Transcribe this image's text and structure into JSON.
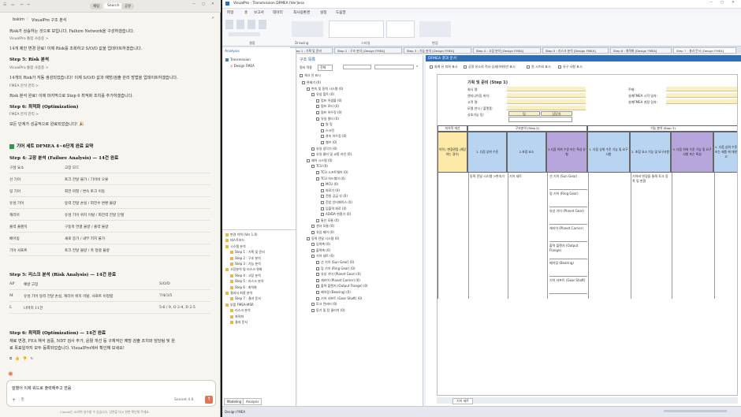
{
  "left": {
    "title": "VisualPro 구조 분석",
    "crumb": "bskim",
    "top_tabs": [
      "채팅",
      "Search",
      "공유"
    ],
    "lines": [
      "Risk가 상승하는 것으로 보입니다. Failure Network을 구성하겠습니다.",
      "VisualPro 통합 사용중 >",
      "14개 제안 변경 완료! 이제 Risk를 조회하고 S/O/D 값을 업데이트하겠습니다.",
      "Step 5: Risk 분석",
      "VisualPro 통합 사용중 >",
      "14개의 Risk가 자동 생성되었습니다! 이제 S/O/D 값과 예방/검출 관리 방법을 업데이트하겠습니다.",
      "FMEA 분석 관리 >",
      "Risk 분석 완료! 이제 마지막으로 Step 6 최적화 조치를 추가하겠습니다.",
      "Step 6: 최적화 (Optimization)",
      "FMEA 분석 관리 >",
      "모든 단계가 성공적으로 완료되었습니다! 🎉"
    ],
    "summary_title": "기어 세트 DFMEA 4~6단계 완료 요약",
    "step4_title": "Step 4: 고장 분석 (Failure Analysis) — 14건 완료",
    "step4_cols": [
      "구성 요소",
      "고장 모드"
    ],
    "step4_rows": [
      [
        "선 기어",
        "토크 전달 불가 / 기어비 오류"
      ],
      [
        "링 기어",
        "회전 마찰 / 변속 토크 이동"
      ],
      [
        "유성 기어",
        "등력 전달 손실 / 회전수 변환 불량"
      ],
      [
        "캐리어",
        "유성 기어 위치 이탈 / 회전력 전달 단절"
      ],
      [
        "출력 플랜지",
        "구동축 연결 불량 / 출력 불량"
      ],
      [
        "베어링",
        "새로 증가 / 내부 지지 불가"
      ],
      [
        "기어 샤프트",
        "토크 전달 불량 / 축 정렬 불량"
      ]
    ],
    "step5_title": "Step 5: 리스크 분석 (Risk Analysis) — 14건 완료",
    "step5_cols": [
      "AP",
      "예방 고장",
      "S/O/D"
    ],
    "step5_rows": [
      [
        "M",
        "유성 기어 등력 전달 손실, 캐리어 위치 이탈, 샤프트 비정렬",
        "7/4/3/5"
      ],
      [
        "L",
        "나머지 11건",
        "5-6 / 9, O 2-4, D 2-5"
      ]
    ],
    "step6_title": "Step 6: 최적화 (Optimization) — 14건 완료",
    "step6_text1": "재료 변경, FEA 해석 검증, NDT 검사 추가, 윤활 개선 등 구체적인 예방·검출 조치와 담당팀 및 완",
    "step6_text2": "료 목표일까지 모두 등록되었습니다. VisualPro에서 확인해 보세요!",
    "input_text": "잘했어 이제 워드로 출력해주고 얻음",
    "model": "Sonnet 4.6",
    "disclaimer": "Claude는 AI이며 실수할 수 있습니다. 답변을 다시 한번 확인해 주세요."
  },
  "right": {
    "window_title": "VisualPro - Transmission DFMEA [Ver]ona",
    "menu": [
      "파일",
      "홈",
      "보고서",
      "데이터",
      "최사용환경",
      "설정",
      "도움말"
    ],
    "ribbon_groups": [
      "결합",
      "Drawing",
      "스타일",
      "편집"
    ],
    "tabs": [
      "Step 1 : 기획 및 준비",
      "Step 2 : 구조 분석 [Design FMEA]",
      "Step 3 : 기능 분석 [Design FMEA]",
      "Step 4 : 고장 분석 [Design FMEA]",
      "Step 5 : 리스크 분석 [Design FMEA]",
      "Step 6 : 최적화 [Design FMEA]",
      "Step 7 : 결과 문서 [Design FMEA]"
    ],
    "analysis_title": "Analysis",
    "analysis_tree": [
      "Transmission",
      "Design FMEA"
    ],
    "struct_title": "구조 목록",
    "struct_opts": [
      "필터 적용",
      "전체",
      "체크 안 표시"
    ],
    "struct_tree": [
      "완제기 (0)",
      "변속 및 동력 시스템 (0)",
      "유일 힐트 (0)",
      "컴프 어셈블 (0)",
      "펌프 로터 (0)",
      "펌프 하우징 (0)",
      "유일 필터 (0)",
      "필 링",
      "스크린",
      "관속 하우징 (0)",
      "밸브 (0)",
      "유일 냉각기 (0)",
      "유일 쿨러 및 교종 라인 (0)",
      "제어 시스템 (0)",
      "TCU (0)",
      "TCU 소프트웨어 (0)",
      "TCU 하드웨어 (0)",
      "MCU (0)",
      "회로기 (0)",
      "전원 공급 부 (0)",
      "전압 인터페이스 (0)",
      "입출력 회로 (0)",
      "AD/DA 변환기 (0)",
      "통신 모듈 (0)",
      "센서 모듈 (0)",
      "유압 제어 (0)",
      "동력 전달 시스템 (0)",
      "입력축 (0)",
      "출력축 (0)",
      "기어 세트 (0)",
      "선 기어 (Sun Gear) (0)",
      "링 기어 (Ring Gear) (0)",
      "유성 기어 (Planet Gear) (0)",
      "캐리어 (Planet Carrier) (0)",
      "출력 플랜지 (Output Flange) (0)",
      "베어링 (Bearing) (0)",
      "기어 샤프트 (Gear Shaft) (0)",
      "토크 컨버터 (0)",
      "동기 및 탕 클러치 (0)"
    ],
    "nav_tree": [
      "변경 이력 (Ver 1.0)",
      "테스트보드",
      "시스템 분석",
      "Step 1 : 기획 및 준비",
      "Step 2 : 구조 분석",
      "Step 3 : 기능 분석",
      "고장분석 및 리스크 완화",
      "Step 4 : 고장 분석",
      "Step 5 : 리스크 분석",
      "Step 6 : 최적화",
      "결과서 최종 분석",
      "Step 7 : 결과 문서",
      "부품 FMEA-MSR",
      "리스크 분석",
      "최적화",
      "결과 문서"
    ],
    "bottom_tabs": [
      "Modeling",
      "Analysis"
    ],
    "doc_title": "DFMEA 결과 문서",
    "doc_opts": [
      "회계 유 미쳐 표시",
      "공정 유소의 적사 상세(하위)만 표시",
      "원 시즈워 표시",
      "유구 사항 표시"
    ],
    "plan_title": "기획 및 준비 (Step 1)",
    "plan_fields": [
      "회사 명:",
      "엔지니어링 위치:",
      "고객 명:",
      "모델 연식 / 플랫폼:",
      "상호기능 팀:"
    ],
    "plan_fields_right": [
      "주제:",
      "설계FMEA 시작 일자:",
      "설계FMEA 개정 일자:"
    ],
    "team_labels": [
      "팀",
      "담당자"
    ],
    "sec_heads": [
      "지속적 개선",
      "구조분석 (Step 2)",
      "기능 분석 (Step 3)"
    ],
    "col_heads": [
      "이력 / 변경관점 (해당하는 경우)",
      "1. 다음 상위 수준",
      "2.초점 요소",
      "3.다음 하위 수준 또는 특성 유형",
      "1. 다음 상위 수준 기능 및 요구사항",
      "2. 초점 요소 기능 및 요구사항",
      "3. 다음 하위 수준 기능 및 요구사항 또는 특성",
      "1. 다음 상위 수준 또는 제품 에 대한 고"
    ],
    "row_upper": "동력 전달 시스템 >변속기",
    "row_focus": "기어 세트",
    "row_func": "기어비 변경을 통해 토크 증폭 및 변환",
    "lower_items": [
      "선 기어 (Sun Gear)",
      "링 기어 (Ring Gear)",
      "유성 기어 (Planet Gear)",
      "캐리어 (Planet Carrier)",
      "출력 플랜지 (Output Flange)",
      "베어링 (Bearing)",
      "기어 샤프트 (Gear Shaft)"
    ],
    "bottom_sheet": "기어 세트",
    "status_left": "Design FMEA"
  }
}
